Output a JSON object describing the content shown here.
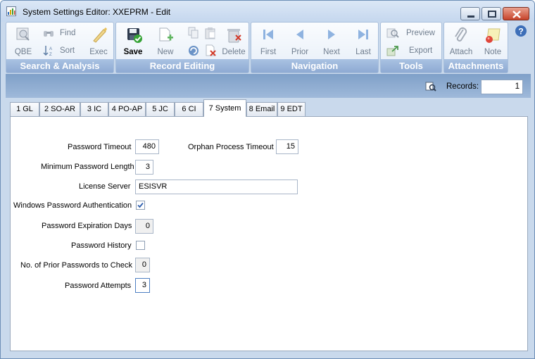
{
  "window": {
    "title": "System Settings Editor: XXEPRM - Edit"
  },
  "toolbar": {
    "groups": {
      "search": {
        "label": "Search & Analysis",
        "qbe": "QBE",
        "find": "Find",
        "sort": "Sort",
        "exec": "Exec"
      },
      "record": {
        "label": "Record Editing",
        "save": "Save",
        "new": "New",
        "delete": "Delete"
      },
      "navigation": {
        "label": "Navigation",
        "first": "First",
        "prior": "Prior",
        "next": "Next",
        "last": "Last"
      },
      "tools": {
        "label": "Tools",
        "preview": "Preview",
        "export": "Export"
      },
      "attachments": {
        "label": "Attachments",
        "attach": "Attach",
        "note": "Note"
      }
    }
  },
  "records": {
    "label": "Records:",
    "value": "1"
  },
  "tabs": [
    {
      "label": "1 GL"
    },
    {
      "label": "2 SO-AR"
    },
    {
      "label": "3 IC"
    },
    {
      "label": "4 PO-AP"
    },
    {
      "label": "5 JC"
    },
    {
      "label": "6 CI"
    },
    {
      "label": "7 System"
    },
    {
      "label": "8 Email"
    },
    {
      "label": "9 EDT"
    }
  ],
  "active_tab": "7 System",
  "form": {
    "password_timeout": {
      "label": "Password Timeout",
      "value": "480"
    },
    "orphan_process_timeout": {
      "label": "Orphan Process Timeout",
      "value": "15"
    },
    "min_password_length": {
      "label": "Minimum Password Length",
      "value": "3"
    },
    "license_server": {
      "label": "License Server",
      "value": "ESISVR"
    },
    "windows_password_auth": {
      "label": "Windows Password Authentication",
      "checked": true
    },
    "password_expiration_days": {
      "label": "Password Expiration Days",
      "value": "0"
    },
    "password_history": {
      "label": "Password History",
      "checked": false
    },
    "prior_passwords_to_check": {
      "label": "No. of Prior Passwords to Check",
      "value": "0"
    },
    "password_attempts": {
      "label": "Password Attempts",
      "value": "3"
    }
  },
  "colors": {
    "accent": "#8eaad3",
    "record_bar": "#8fabd0",
    "check": "#2f5fae"
  }
}
